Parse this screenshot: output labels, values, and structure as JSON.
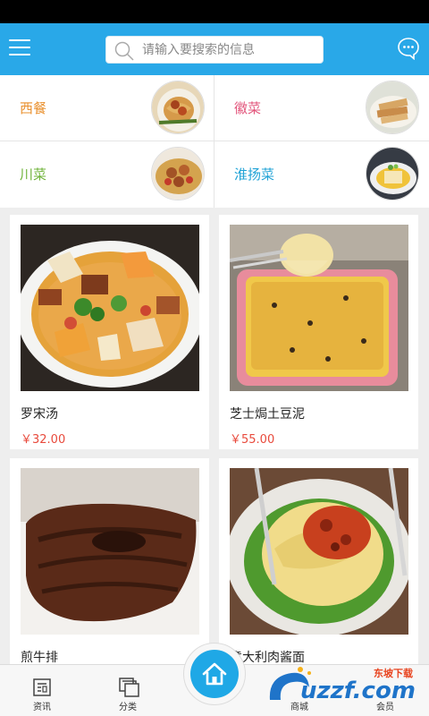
{
  "header": {
    "search_placeholder": "请输入要搜索的信息"
  },
  "categories": [
    {
      "label": "西餐",
      "color": "#e9902e"
    },
    {
      "label": "徽菜",
      "color": "#e2537a"
    },
    {
      "label": "川菜",
      "color": "#6fb33a"
    },
    {
      "label": "淮扬菜",
      "color": "#21a3d6"
    }
  ],
  "products": [
    {
      "name": "罗宋汤",
      "price": "￥32.00"
    },
    {
      "name": "芝士焗土豆泥",
      "price": "￥55.00"
    },
    {
      "name": "煎牛排",
      "price": ""
    },
    {
      "name": "意大利肉酱面",
      "price": ""
    }
  ],
  "tabbar": {
    "tabs": [
      {
        "label": "资讯"
      },
      {
        "label": "分类"
      },
      {
        "label": "商城"
      },
      {
        "label": "会员"
      }
    ]
  },
  "watermark": {
    "brand": "uzzf.com",
    "tagline": "东坡下载"
  },
  "colors": {
    "primary": "#29a8e8",
    "price": "#e84a3c"
  }
}
